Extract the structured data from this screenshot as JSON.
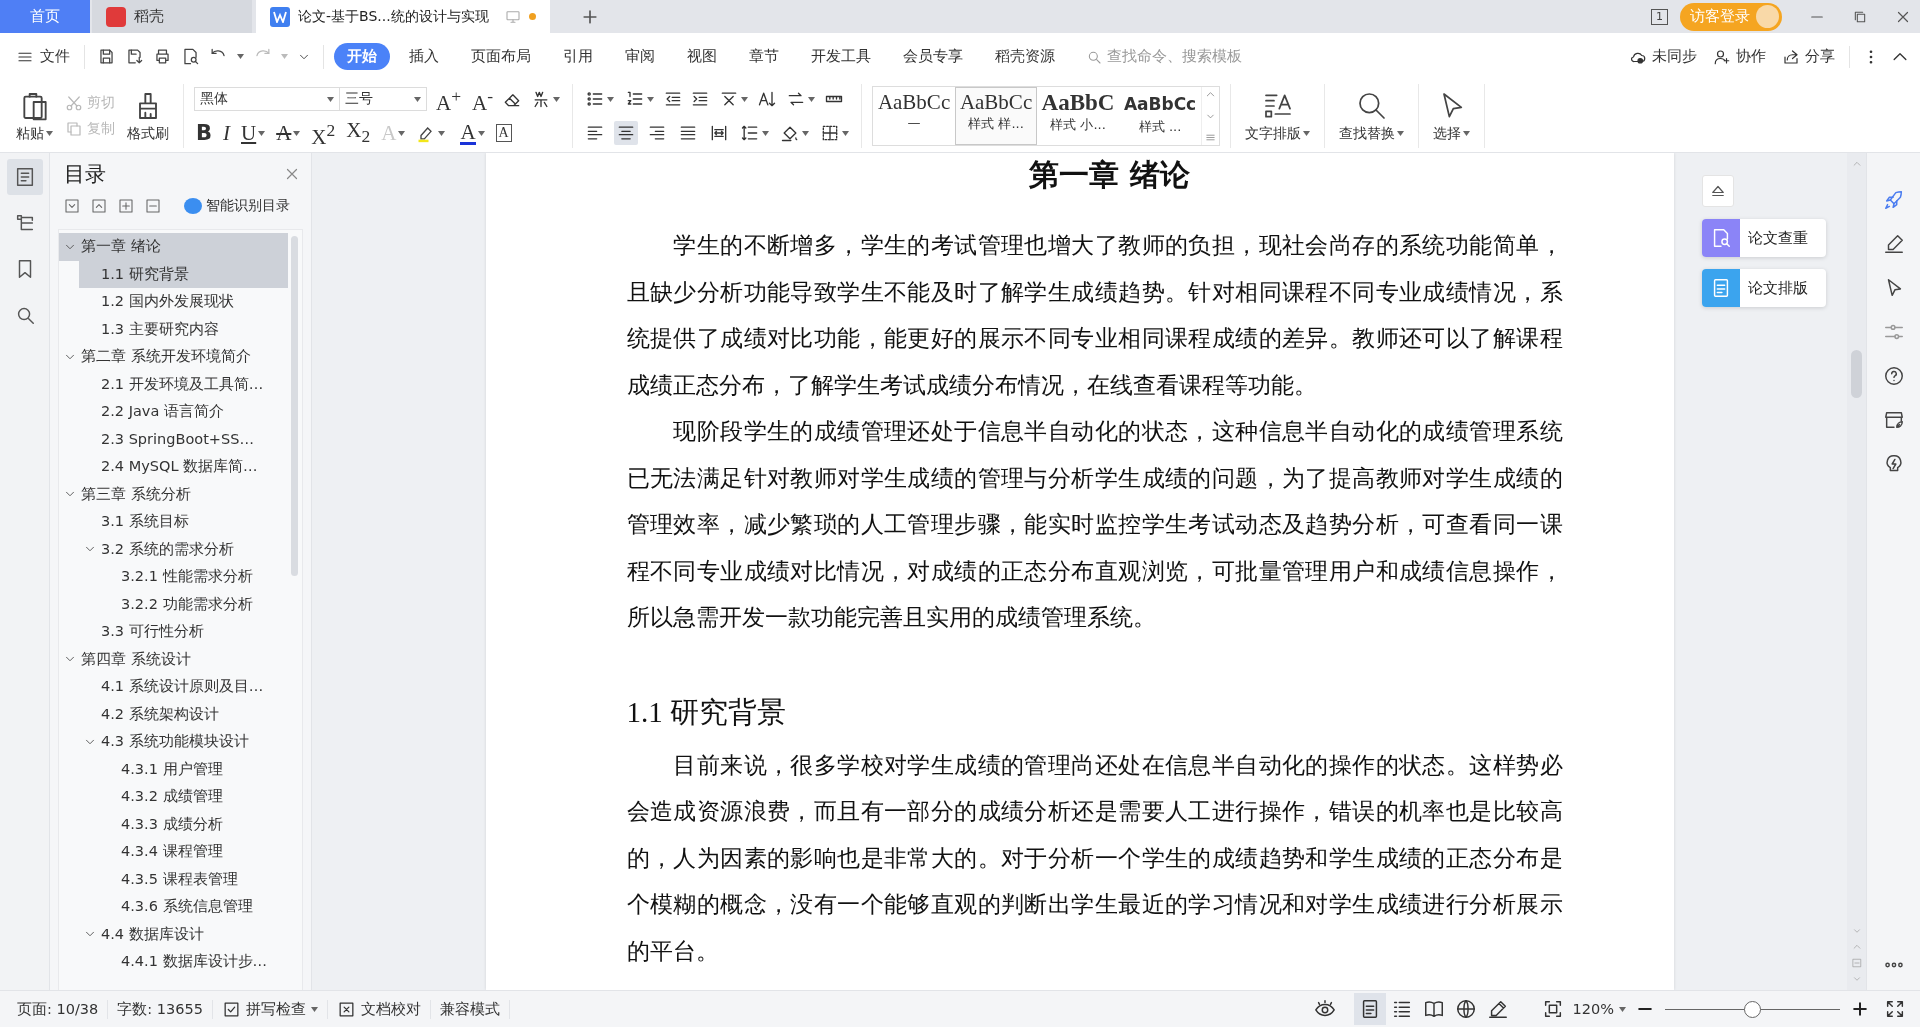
{
  "title_bar": {
    "tabs": [
      {
        "label": "首页",
        "kind": "home",
        "selected": false
      },
      {
        "label": "稻壳",
        "kind": "store",
        "selected": false
      },
      {
        "label": "论文-基于BS...统的设计与实现",
        "kind": "document",
        "selected": true,
        "unsaved": true
      }
    ],
    "window_badge": "1",
    "login_button": "访客登录"
  },
  "menu_bar": {
    "file_menu": "文件",
    "tabs": [
      {
        "label": "开始",
        "selected": true
      },
      {
        "label": "插入",
        "selected": false
      },
      {
        "label": "页面布局",
        "selected": false
      },
      {
        "label": "引用",
        "selected": false
      },
      {
        "label": "审阅",
        "selected": false
      },
      {
        "label": "视图",
        "selected": false
      },
      {
        "label": "章节",
        "selected": false
      },
      {
        "label": "开发工具",
        "selected": false
      },
      {
        "label": "会员专享",
        "selected": false
      },
      {
        "label": "稻壳资源",
        "selected": false
      }
    ],
    "search": {
      "placeholder": "查找命令、搜索模板"
    },
    "actions": [
      {
        "label": "未同步",
        "kind": "cloud"
      },
      {
        "label": "协作",
        "kind": "collab"
      },
      {
        "label": "分享",
        "kind": "share"
      }
    ]
  },
  "ribbon": {
    "clipboard": {
      "paste": "粘贴",
      "cut": {
        "label": "剪切",
        "disabled": true
      },
      "copy": {
        "label": "复制",
        "disabled": true
      },
      "format_painter": "格式刷"
    },
    "font": {
      "name": "黑体",
      "size": "三号",
      "size_glyphs": [
        {
          "kind": "plain",
          "text": "A$^{+}$"
        },
        {
          "kind": "plain",
          "text": "A$^{-}$"
        }
      ],
      "glyphs": [
        {
          "kind": "bold",
          "text": "B"
        },
        {
          "kind": "italic",
          "text": "I"
        },
        {
          "kind": "underline",
          "text": "U"
        },
        {
          "kind": "strike",
          "text": "A"
        },
        {
          "kind": "plain",
          "text": "X$^{2}$"
        },
        {
          "kind": "plain",
          "text": "X$_{2}$"
        },
        {
          "kind": "outline",
          "text": "A"
        },
        {
          "kind": "color",
          "text": "A"
        },
        {
          "kind": "boxed",
          "text": "A"
        }
      ]
    },
    "paragraph": {
      "alignments": [
        {
          "kind": "left",
          "selected": false
        },
        {
          "kind": "center",
          "selected": true
        },
        {
          "kind": "right",
          "selected": false
        },
        {
          "kind": "justify",
          "selected": false
        },
        {
          "kind": "distributed",
          "selected": false
        }
      ]
    },
    "styles": [
      {
        "preview": "AaBbCc",
        "name": "—",
        "selected": false
      },
      {
        "preview": "AaBbCc",
        "name": "样式 样...",
        "selected": true
      },
      {
        "preview": "AaBbC",
        "name": "样式 小...",
        "selected": false
      },
      {
        "preview": "AaBbCc",
        "name": "样式 ...",
        "selected": false
      }
    ],
    "big_buttons": [
      {
        "label": "文字排版",
        "kind": "text-layout"
      },
      {
        "label": "查找替换",
        "kind": "find"
      },
      {
        "label": "选择",
        "kind": "select"
      }
    ]
  },
  "toc": {
    "title": "目录",
    "smart_button": "智能识别目录",
    "items": [
      {
        "label": "第一章  绪论",
        "selected": true,
        "expanded": true,
        "children": [
          {
            "label": "1.1  研究背景",
            "selected": true
          },
          {
            "label": "1.2  国内外发展现状",
            "selected": false
          },
          {
            "label": "1.3  主要研究内容",
            "selected": false
          }
        ]
      },
      {
        "label": "第二章  系统开发环境简介",
        "selected": false,
        "expanded": true,
        "children": [
          {
            "label": "2.1  开发环境及工具简…",
            "selected": false
          },
          {
            "label": "2.2 Java 语言简介",
            "selected": false
          },
          {
            "label": "2.3 SpringBoot+SS…",
            "selected": false
          },
          {
            "label": "2.4 MySQL 数据库简…",
            "selected": false
          }
        ]
      },
      {
        "label": "第三章  系统分析",
        "selected": false,
        "expanded": true,
        "children": [
          {
            "label": "3.1  系统目标",
            "selected": false
          },
          {
            "label": "3.2  系统的需求分析",
            "selected": false,
            "expanded": true,
            "children": [
              {
                "label": "3.2.1  性能需求分析",
                "selected": false
              },
              {
                "label": "3.2.2  功能需求分析",
                "selected": false
              }
            ]
          },
          {
            "label": "3.3  可行性分析",
            "selected": false
          }
        ]
      },
      {
        "label": "第四章  系统设计",
        "selected": false,
        "expanded": true,
        "children": [
          {
            "label": "4.1  系统设计原则及目…",
            "selected": false
          },
          {
            "label": "4.2  系统架构设计",
            "selected": false
          },
          {
            "label": "4.3  系统功能模块设计",
            "selected": false,
            "expanded": true,
            "children": [
              {
                "label": "4.3.1  用户管理",
                "selected": false
              },
              {
                "label": "4.3.2  成绩管理",
                "selected": false
              },
              {
                "label": "4.3.3  成绩分析",
                "selected": false
              },
              {
                "label": "4.3.4  课程管理",
                "selected": false
              },
              {
                "label": "4.3.5  课程表管理",
                "selected": false
              },
              {
                "label": "4.3.6  系统信息管理",
                "selected": false
              }
            ]
          },
          {
            "label": "4.4  数据库设计",
            "selected": false,
            "expanded": true,
            "children": [
              {
                "label": "4.4.1  数据库设计步…",
                "selected": false
              }
            ]
          }
        ]
      }
    ]
  },
  "document": {
    "blocks": [
      {
        "kind": "chapter",
        "text": "第一章  绪论"
      },
      {
        "kind": "paragraph",
        "text": "学生的不断增多，学生的考试管理也增大了教师的负担，现社会尚存的系统功能简单，且缺少分析功能导致学生不能及时了解学生成绩趋势。针对相同课程不同专业成绩情况，系统提供了成绩对比功能，能更好的展示不同专业相同课程成绩的差异。教师还可以了解课程成绩正态分布，了解学生考试成绩分布情况，在线查看课程等功能。"
      },
      {
        "kind": "paragraph",
        "text": "现阶段学生的成绩管理还处于信息半自动化的状态，这种信息半自动化的成绩管理系统已无法满足针对教师对学生成绩的管理与分析学生成绩的问题，为了提高教师对学生成绩的管理效率，减少繁琐的人工管理步骤，能实时监控学生考试动态及趋势分析，可查看同一课程不同专业成绩对比情况，对成绩的正态分布直观浏览，可批量管理用户和成绩信息操作，所以急需开发一款功能完善且实用的成绩管理系统。"
      },
      {
        "kind": "section",
        "text": "1.1  研究背景"
      },
      {
        "kind": "paragraph",
        "text": "目前来说，很多学校对学生成绩的管理尚还处在信息半自动化的操作的状态。这样势必会造成资源浪费，而且有一部分的成绩分析还是需要人工进行操作，错误的机率也是比较高的，人为因素的影响也是非常大的。对于分析一个学生的成绩趋势和学生成绩的正态分布是个模糊的概念，没有一个能够直观的判断出学生最近的学习情况和对学生成绩进行分析展示的平台。"
      }
    ]
  },
  "side_tools": [
    {
      "label": "论文查重",
      "color": "#8b84f7"
    },
    {
      "label": "论文排版",
      "color": "#3ba4ee"
    }
  ],
  "status_bar": {
    "page": "页面: 10/38",
    "words": "字数: 13655",
    "spell_check": "拼写检查",
    "proofread": "文档校对",
    "mode": "兼容模式",
    "views": [
      {
        "kind": "page",
        "selected": true
      },
      {
        "kind": "outline",
        "selected": false
      },
      {
        "kind": "reading",
        "selected": false
      },
      {
        "kind": "web",
        "selected": false
      },
      {
        "kind": "write",
        "selected": false
      }
    ],
    "zoom": {
      "value": "120%",
      "level": 0.5
    }
  }
}
